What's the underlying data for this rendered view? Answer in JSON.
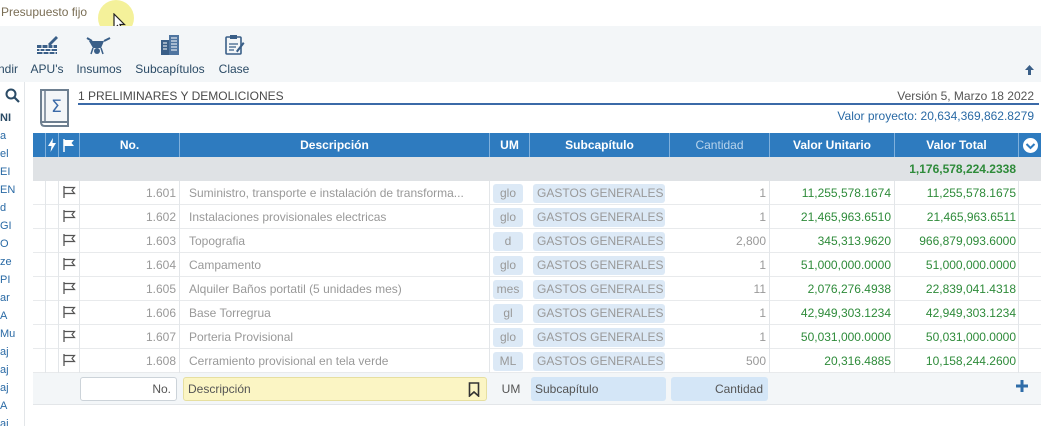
{
  "topbar": {
    "title": "Presupuesto fijo"
  },
  "toolbar": {
    "items": [
      {
        "label": "ndir",
        "icon": "expand-icon"
      },
      {
        "label": "APU's",
        "icon": "brick-wall-icon"
      },
      {
        "label": "Insumos",
        "icon": "wheelbarrow-icon"
      },
      {
        "label": "Subcapítulos",
        "icon": "buildings-icon"
      },
      {
        "label": "Clase",
        "icon": "clipboard-icon"
      }
    ]
  },
  "left_panel": {
    "fragments": [
      "NI",
      "a",
      "el",
      "EI",
      "EN",
      "d",
      "GI",
      "O",
      "ze",
      "PI",
      "ar",
      "A",
      "Mu",
      "aj",
      "aj",
      "aj",
      "A",
      "aj"
    ]
  },
  "section": {
    "title": "1 PRELIMINARES Y DEMOLICIONES",
    "version": "Versión 5, Marzo 18 2022",
    "valor_proyecto": "Valor proyecto: 20,634,369,862.8279"
  },
  "table": {
    "columns": {
      "no": "No.",
      "descripcion": "Descripción",
      "um": "UM",
      "subcapitulo": "Subcapítulo",
      "cantidad": "Cantidad",
      "valor_unitario": "Valor Unitario",
      "valor_total": "Valor Total"
    },
    "total": "1,176,578,224.2338",
    "rows": [
      {
        "no": "1.601",
        "descripcion": "Suministro, transporte e instalación de transforma...",
        "um": "glo",
        "subcapitulo": "GASTOS GENERALES",
        "cantidad": "1",
        "valor_unitario": "11,255,578.1674",
        "valor_total": "11,255,578.1675"
      },
      {
        "no": "1.602",
        "descripcion": "Instalaciones provisionales electricas",
        "um": "glo",
        "subcapitulo": "GASTOS GENERALES",
        "cantidad": "1",
        "valor_unitario": "21,465,963.6510",
        "valor_total": "21,465,963.6511"
      },
      {
        "no": "1.603",
        "descripcion": "Topografia",
        "um": "d",
        "subcapitulo": "GASTOS GENERALES",
        "cantidad": "2,800",
        "valor_unitario": "345,313.9620",
        "valor_total": "966,879,093.6000"
      },
      {
        "no": "1.604",
        "descripcion": "Campamento",
        "um": "glo",
        "subcapitulo": "GASTOS GENERALES",
        "cantidad": "1",
        "valor_unitario": "51,000,000.0000",
        "valor_total": "51,000,000.0000"
      },
      {
        "no": "1.605",
        "descripcion": "Alquiler Baños portatil (5 unidades mes)",
        "um": "mes",
        "subcapitulo": "GASTOS GENERALES",
        "cantidad": "11",
        "valor_unitario": "2,076,276.4938",
        "valor_total": "22,839,041.4318"
      },
      {
        "no": "1.606",
        "descripcion": "Base Torregrua",
        "um": "gl",
        "subcapitulo": "GASTOS GENERALES",
        "cantidad": "1",
        "valor_unitario": "42,949,303.1234",
        "valor_total": "42,949,303.1234"
      },
      {
        "no": "1.607",
        "descripcion": "Porteria Provisional",
        "um": "glo",
        "subcapitulo": "GASTOS GENERALES",
        "cantidad": "1",
        "valor_unitario": "50,031,000.0000",
        "valor_total": "50,031,000.0000"
      },
      {
        "no": "1.608",
        "descripcion": "Cerramiento provisional en tela verde",
        "um": "ML",
        "subcapitulo": "GASTOS GENERALES",
        "cantidad": "500",
        "valor_unitario": "20,316.4885",
        "valor_total": "10,158,244.2600"
      }
    ],
    "new_row": {
      "no_placeholder": "No.",
      "descripcion_placeholder": "Descripción",
      "um": "UM",
      "subcapitulo_placeholder": "Subcapítulo",
      "cantidad_placeholder": "Cantidad"
    }
  },
  "colors": {
    "header_blue": "#2e7bbf",
    "value_green": "#2e8b3a",
    "accent_blue": "#3b6aa8"
  }
}
